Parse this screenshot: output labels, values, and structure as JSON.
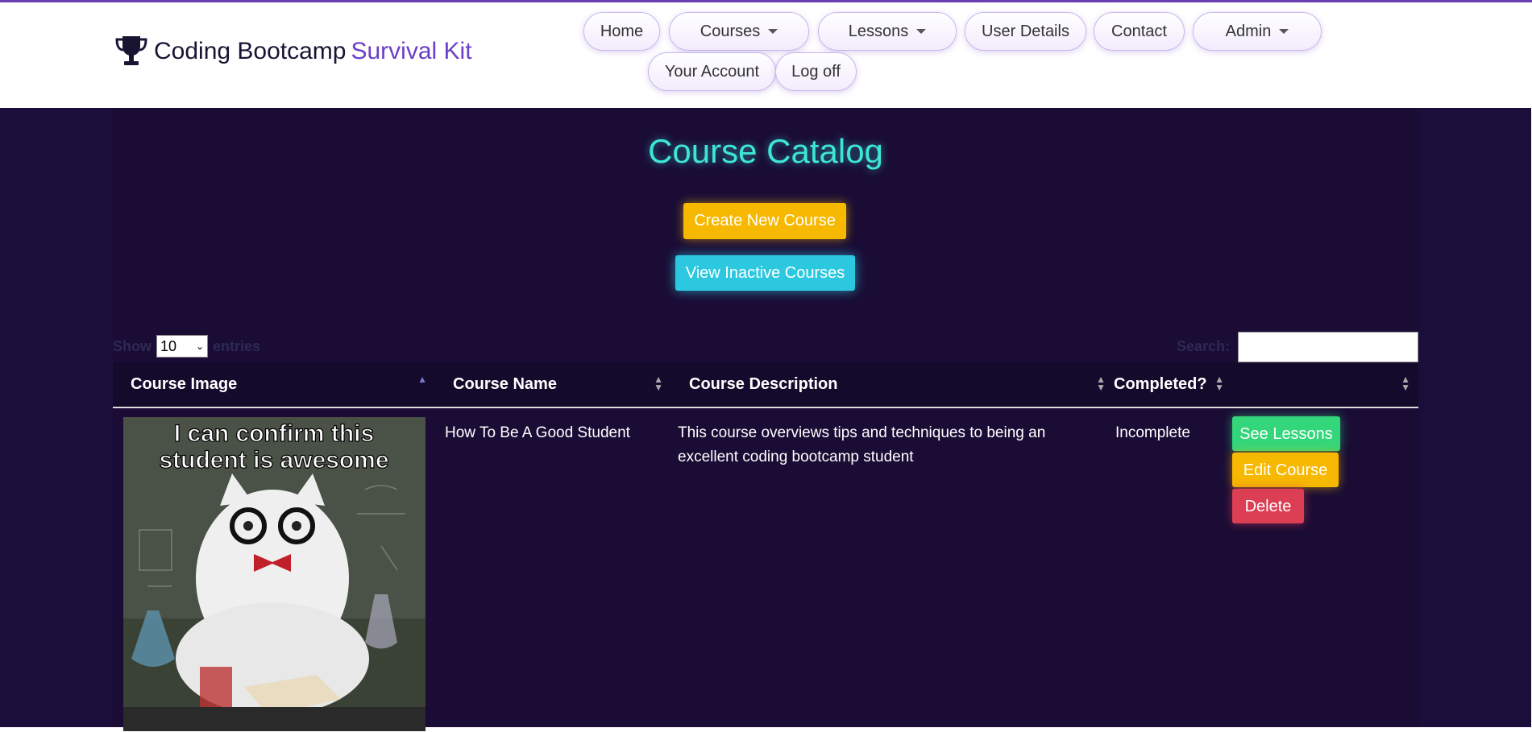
{
  "brand": {
    "text_a": "Coding Bootcamp ",
    "text_b": "Survival Kit"
  },
  "nav": {
    "home": "Home",
    "courses": "Courses",
    "lessons": "Lessons",
    "user_details": "User Details",
    "contact": "Contact",
    "admin": "Admin",
    "your_account": "Your Account",
    "log_off": "Log off"
  },
  "page": {
    "title": "Course Catalog",
    "create_btn": "Create New Course",
    "inactive_btn": "View Inactive Courses"
  },
  "table_controls": {
    "show_label": "Show",
    "entries_value": "10",
    "entries_label": "entries",
    "search_label": "Search:",
    "search_value": ""
  },
  "table": {
    "headers": [
      "Course Image",
      "Course Name",
      "Course Description",
      "Completed?",
      ""
    ],
    "rows": [
      {
        "image_caption": "I can confirm this student is awesome",
        "name": "How To Be A Good Student",
        "description": "This course overviews tips and techniques to being an excellent coding bootcamp student",
        "completed": "Incomplete",
        "actions": {
          "see": "See Lessons",
          "edit": "Edit Course",
          "delete": "Delete"
        }
      }
    ]
  },
  "colors": {
    "accent": "#6b3fc7",
    "title": "#3de6d6",
    "bg": "#1a0c35",
    "yellow": "#f6b800",
    "cyan": "#2cc8e0",
    "green": "#33d67a",
    "red": "#dc3f53"
  },
  "icons": [
    "trophy-icon",
    "chevron-down-icon",
    "sort-icon"
  ]
}
